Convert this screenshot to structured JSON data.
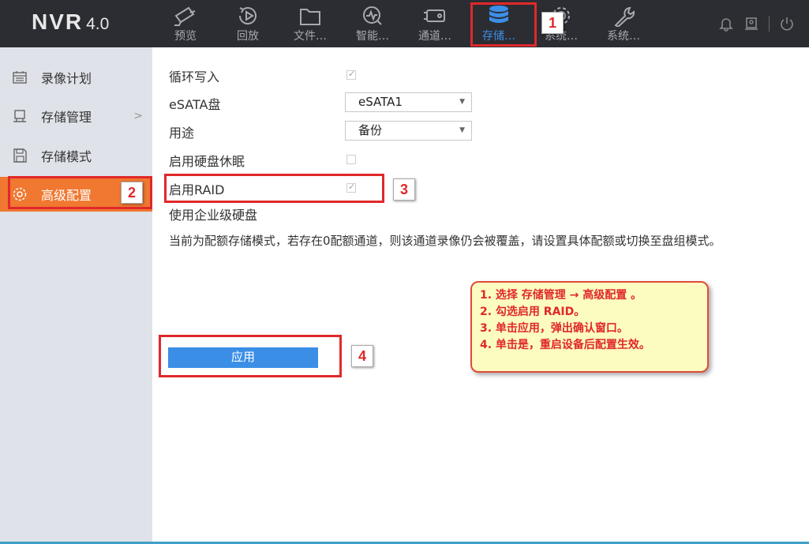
{
  "app": {
    "brand": "NVR",
    "version": "4.0"
  },
  "topnav": [
    {
      "label": "预览",
      "icon": "camera-icon"
    },
    {
      "label": "回放",
      "icon": "playback-icon"
    },
    {
      "label": "文件…",
      "icon": "folder-icon"
    },
    {
      "label": "智能…",
      "icon": "smart-icon"
    },
    {
      "label": "通道…",
      "icon": "channel-icon"
    },
    {
      "label": "存储…",
      "icon": "database-icon"
    },
    {
      "label": "系统…",
      "icon": "gear-icon"
    },
    {
      "label": "系统…",
      "icon": "wrench-icon"
    }
  ],
  "sidebar": {
    "items": [
      {
        "label": "录像计划",
        "icon": "calendar-icon"
      },
      {
        "label": "存储管理",
        "icon": "storage-icon"
      },
      {
        "label": "存储模式",
        "icon": "save-icon"
      },
      {
        "label": "高级配置",
        "icon": "settings-icon"
      }
    ],
    "active": "高级配置"
  },
  "form": {
    "loop_write_label": "循环写入",
    "loop_write_checked": true,
    "esata_label": "eSATA盘",
    "esata_value": "eSATA1",
    "usage_label": "用途",
    "usage_value": "备份",
    "hdd_sleep_label": "启用硬盘休眠",
    "hdd_sleep_checked": false,
    "raid_label": "启用RAID",
    "raid_checked": true,
    "enterprise_label": "使用企业级硬盘",
    "notice": "当前为配额存储模式，若存在0配额通道，则该通道录像仍会被覆盖，请设置具体配额或切换至盘组模式。",
    "apply_label": "应用"
  },
  "annotations": {
    "badges": [
      "1",
      "2",
      "3",
      "4"
    ],
    "tips": [
      "1. 选择 存储管理 → 高级配置 。",
      "2. 勾选启用 RAID。",
      "3. 单击应用，弹出确认窗口。",
      "4. 单击是，重启设备后配置生效。"
    ],
    "highlight_color": "#e0282a"
  }
}
